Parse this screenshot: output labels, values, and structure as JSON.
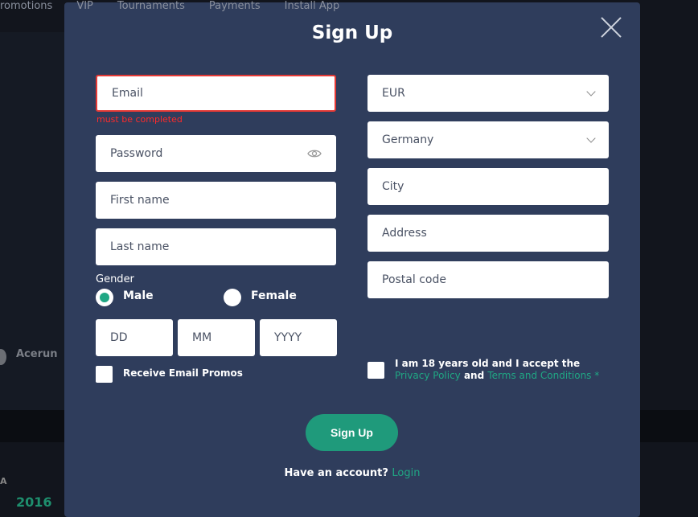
{
  "background": {
    "nav": [
      "romotions",
      "VIP",
      "Tournaments",
      "Payments",
      "Install App"
    ],
    "user_name": "Acerun",
    "letter": "A",
    "number": "2016"
  },
  "modal": {
    "title": "Sign Up",
    "email": {
      "placeholder": "Email",
      "error": "must be completed"
    },
    "password": {
      "placeholder": "Password"
    },
    "first_name": {
      "placeholder": "First name"
    },
    "last_name": {
      "placeholder": "Last name"
    },
    "gender": {
      "label": "Gender",
      "options": [
        "Male",
        "Female"
      ],
      "selected": "Male"
    },
    "dob": {
      "day": "DD",
      "month": "MM",
      "year": "YYYY"
    },
    "promos_label": "Receive Email Promos",
    "currency": "EUR",
    "country": "Germany",
    "city": {
      "placeholder": "City"
    },
    "address": {
      "placeholder": "Address"
    },
    "postal": {
      "placeholder": "Postal code"
    },
    "terms": {
      "text1": "I am 18 years old and I accept the ",
      "privacy": "Privacy Policy",
      "and": " and ",
      "terms": "Terms and Conditions",
      "asterisk": " *"
    },
    "submit": "Sign Up",
    "footer": {
      "text": "Have an account? ",
      "login": "Login"
    }
  },
  "colors": {
    "accent": "#20a784",
    "error": "#ff2a2a",
    "modal_bg": "#2f3d5c"
  }
}
